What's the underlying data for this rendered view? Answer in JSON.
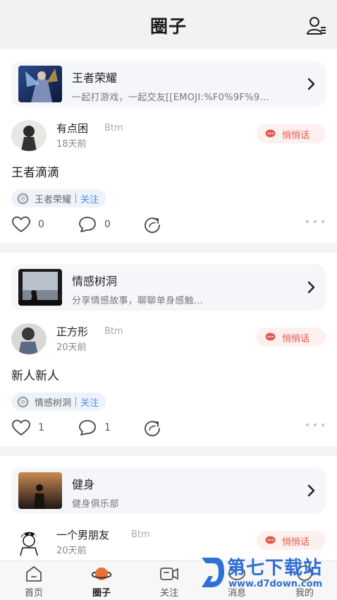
{
  "header": {
    "title": "圈子"
  },
  "posts": [
    {
      "circle": {
        "name": "王者荣耀",
        "desc": "一起打游戏，一起交友[[EMOJI:%F0%9F%9..."
      },
      "author": {
        "name": "有点困",
        "tag": "Btm",
        "time": "18天前"
      },
      "whisper_label": "悄悄话",
      "content": "王者滴滴",
      "tag": {
        "name": "王者荣耀",
        "follow": "关注"
      },
      "likes": "0",
      "comments": "0"
    },
    {
      "circle": {
        "name": "情感树洞",
        "desc": "分享情感故事，聊聊单身感触..."
      },
      "author": {
        "name": "正方形",
        "tag": "Btm",
        "time": "20天前"
      },
      "whisper_label": "悄悄话",
      "content": "新人新人",
      "tag": {
        "name": "情感树洞",
        "follow": "关注"
      },
      "likes": "1",
      "comments": "1"
    },
    {
      "circle": {
        "name": "健身",
        "desc": "健身俱乐部"
      },
      "author": {
        "name": "一个男朋友",
        "tag": "Btm",
        "time": "20天前"
      },
      "whisper_label": "悄悄话"
    }
  ],
  "tabbar": {
    "items": [
      {
        "label": "首页"
      },
      {
        "label": "圈子"
      },
      {
        "label": "关注"
      },
      {
        "label": "消息"
      },
      {
        "label": "我的"
      }
    ]
  },
  "watermark": {
    "main": "第七下载站",
    "sub": "www.d7down.com"
  },
  "colors": {
    "accent_red": "#e05a50",
    "follow_blue": "#4a90e2",
    "brand_orange": "#e8703a"
  }
}
